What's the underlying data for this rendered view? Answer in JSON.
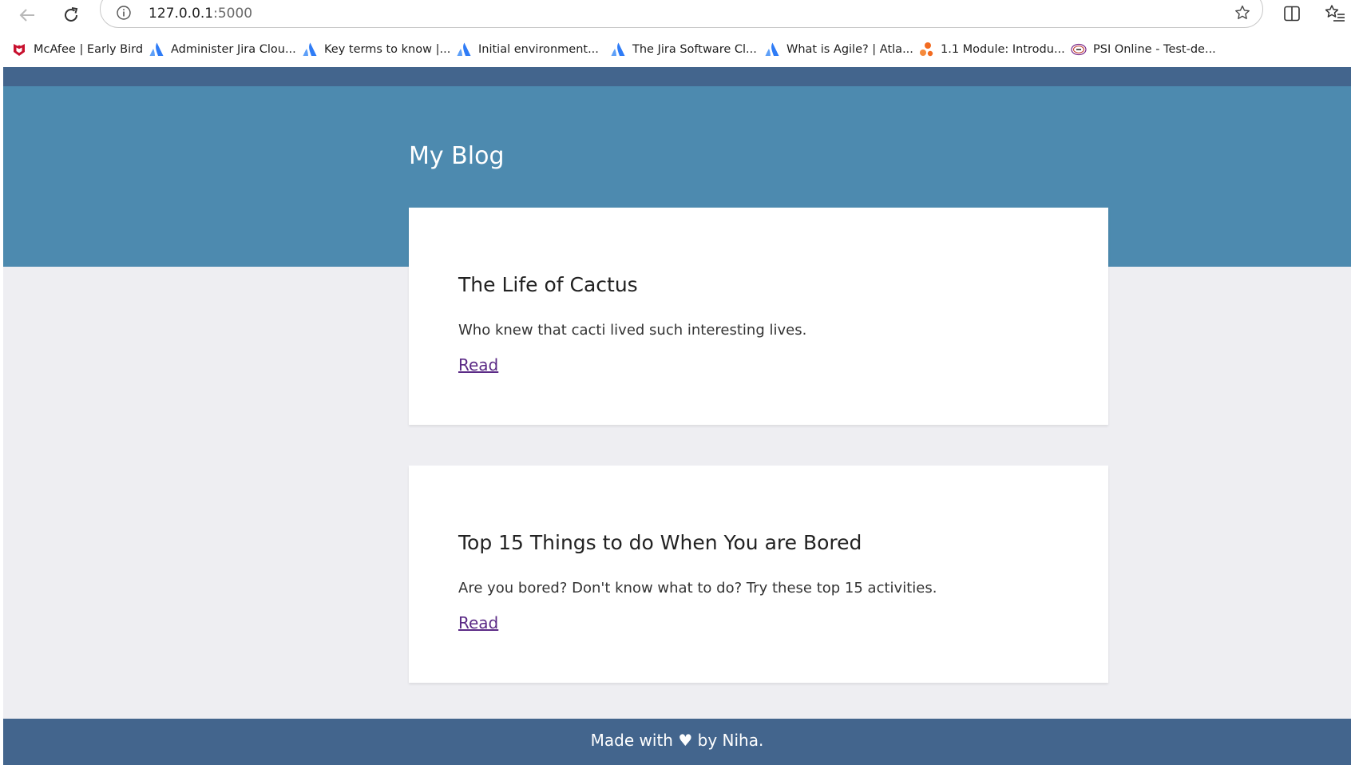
{
  "browser": {
    "url_host": "127.0.0.1",
    "url_port": ":5000",
    "bookmarks": [
      {
        "label": "McAfee | Early Bird",
        "icon": "mcafee-icon"
      },
      {
        "label": "Administer Jira Clou...",
        "icon": "atlassian-icon"
      },
      {
        "label": "Key terms to know |...",
        "icon": "atlassian-icon"
      },
      {
        "label": "Initial environment...",
        "icon": "atlassian-icon"
      },
      {
        "label": "The Jira Software Cl...",
        "icon": "atlassian-icon"
      },
      {
        "label": "What is Agile? | Atla...",
        "icon": "atlassian-icon"
      },
      {
        "label": "1.1 Module: Introdu...",
        "icon": "orange-dots-icon"
      },
      {
        "label": "PSI Online - Test-de...",
        "icon": "psi-icon"
      }
    ]
  },
  "site": {
    "title": "My Blog"
  },
  "posts": [
    {
      "title": "The Life of Cactus",
      "excerpt": "Who knew that cacti lived such interesting lives.",
      "link_label": "Read"
    },
    {
      "title": "Top 15 Things to do When You are Bored",
      "excerpt": "Are you bored? Don't know what to do? Try these top 15 activities.",
      "link_label": "Read"
    }
  ],
  "footer": {
    "text": "Made with ♥ by Niha."
  },
  "colors": {
    "header_strip": "#43658d",
    "hero": "#4d8aaf",
    "page_bg": "#eeeef2",
    "link": "#5b2a86",
    "atlassian_blue": "#2f7cf6",
    "mcafee_red": "#c8102e"
  }
}
